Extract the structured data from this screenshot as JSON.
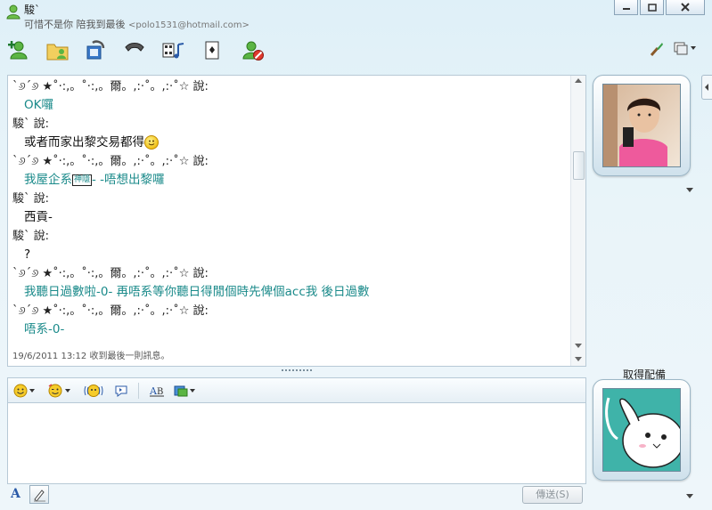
{
  "window": {
    "title": "駿`",
    "subtitle": "可惜不是你 陪我到最後",
    "email": "<polo1531@hotmail.com>"
  },
  "toolbar": {
    "icons": [
      "add-contact-icon",
      "share-folder-icon",
      "video-call-icon",
      "phone-call-icon",
      "media-icon",
      "games-icon",
      "block-icon",
      "paint-icon",
      "display-menu-icon"
    ]
  },
  "conversation": {
    "lines": [
      {
        "type": "sender",
        "text": "ˋ୬ˊ୬           ★˚·:,。˚·:,。爾。,:·˚。,:·˚☆ 說:"
      },
      {
        "type": "message",
        "text": "OK囉"
      },
      {
        "type": "sender",
        "text": "駿` 說:"
      },
      {
        "type": "message_black",
        "text": "或者而家出黎交易都得"
      },
      {
        "type": "sender",
        "text": "ˋ୬ˊ୬           ★˚·:,。˚·:,。爾。,:·˚。,:·˚☆ 說:"
      },
      {
        "type": "message",
        "text_before": "我屋企系",
        "tag": "神隱",
        "text_after": "- -唔想出黎囉"
      },
      {
        "type": "sender",
        "text": "駿` 說:"
      },
      {
        "type": "message_black",
        "text": "西貢-"
      },
      {
        "type": "sender",
        "text": "駿` 說:"
      },
      {
        "type": "message_black",
        "text": "?"
      },
      {
        "type": "sender",
        "text": "ˋ୬ˊ୬           ★˚·:,。˚·:,。爾。,:·˚。,:·˚☆ 說:"
      },
      {
        "type": "message",
        "text": "我聽日過數啦-0- 再唔系等你聽日得閒個時先俾個acc我 後日過數"
      },
      {
        "type": "sender",
        "text": "ˋ୬ˊ୬           ★˚·:,。˚·:,。爾。,:·˚。,:·˚☆ 說:"
      },
      {
        "type": "message",
        "text": "唔系-0-"
      }
    ],
    "status": "19/6/2011 13:12 收到最後一則訊息。"
  },
  "compose": {
    "toolbar_icons": [
      "emoticon-icon",
      "wink-icon",
      "nudge-icon",
      "voice-clip-icon",
      "font-icon",
      "background-icon"
    ],
    "value": "",
    "send_label": "傳送(S)"
  },
  "right_panel": {
    "get_label": "取得配備"
  },
  "colors": {
    "message_teal": "#1a8a8a",
    "background": "#e4f1f8"
  }
}
